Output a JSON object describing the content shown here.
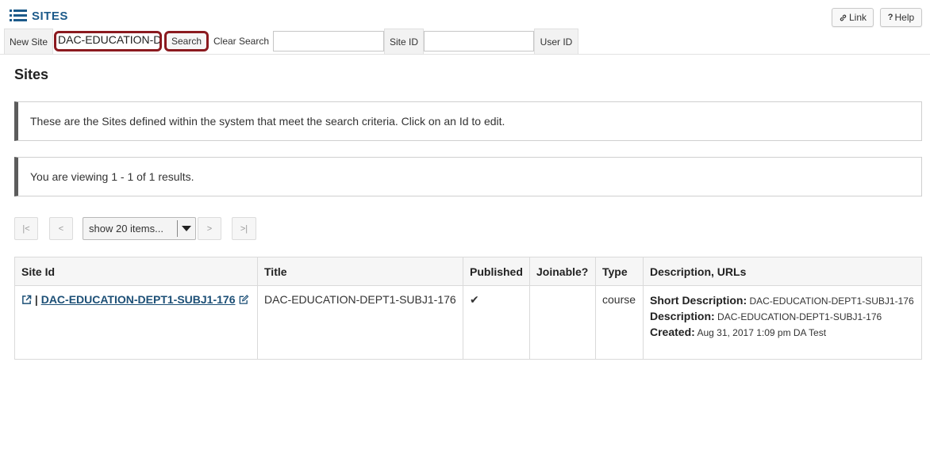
{
  "header": {
    "tool_title": "SITES",
    "link_label": "Link",
    "help_label": "Help"
  },
  "toolbar": {
    "new_site_label": "New Site",
    "search_value": "DAC-EDUCATION-D",
    "search_button": "Search",
    "clear_search": "Clear Search",
    "site_id_label": "Site ID",
    "user_id_label": "User ID"
  },
  "main": {
    "heading": "Sites",
    "instructions": "These are the Sites defined within the system that meet the search criteria. Click on an Id to edit.",
    "results_text": "You are viewing 1 - 1 of 1 results."
  },
  "pager": {
    "first": "|<",
    "prev": "<",
    "page_size": "show 20 items...",
    "next": ">",
    "last": ">|"
  },
  "table": {
    "headers": [
      "Site Id",
      "Title",
      "Published",
      "Joinable?",
      "Type",
      "Description, URLs"
    ],
    "rows": [
      {
        "site_id": "DAC-EDUCATION-DEPT1-SUBJ1-176",
        "title": "DAC-EDUCATION-DEPT1-SUBJ1-176",
        "published": "✔",
        "joinable": "",
        "type": "course",
        "short_desc_label": "Short Description:",
        "short_desc": "DAC-EDUCATION-DEPT1-SUBJ1-176",
        "desc_label": "Description:",
        "desc": "DAC-EDUCATION-DEPT1-SUBJ1-176",
        "created_label": "Created:",
        "created": "Aug 31, 2017 1:09 pm DA Test"
      }
    ]
  },
  "colors": {
    "accent": "#1c5a8a",
    "highlight_border": "#8b1a1f",
    "link": "#1c4f76"
  },
  "icons": [
    "list-icon",
    "link-icon",
    "help-icon",
    "external-link-icon",
    "edit-icon",
    "chevron-down-icon"
  ]
}
